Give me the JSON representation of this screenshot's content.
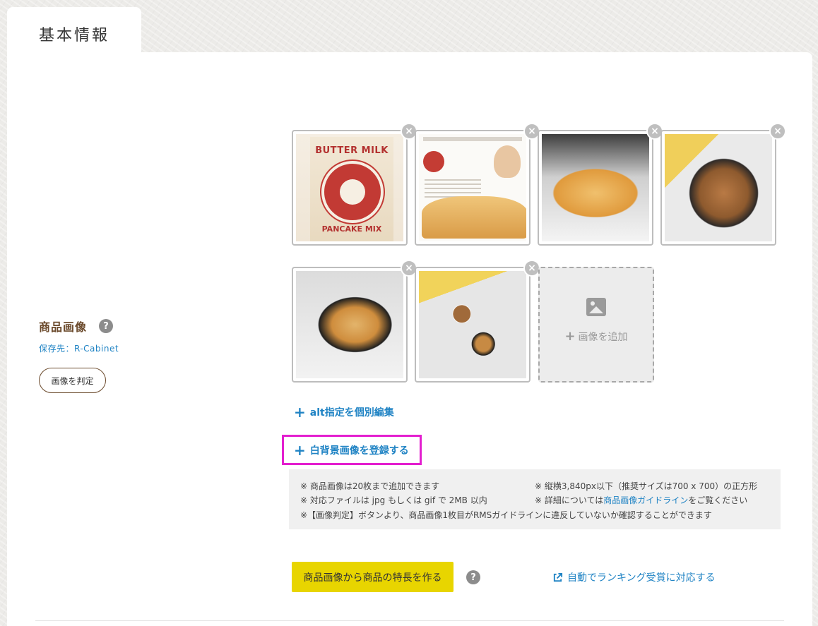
{
  "tab": {
    "label": "基本情報"
  },
  "product_image": {
    "label": "商品画像",
    "help": "?",
    "storage_label": "保存先：R-Cabinet",
    "judge_button": "画像を判定"
  },
  "images": [
    {
      "icon": "product-package-image"
    },
    {
      "icon": "product-flyer-image"
    },
    {
      "icon": "pancake-photo"
    },
    {
      "icon": "pancake-skillet-photo"
    },
    {
      "icon": "pancake-skillet-photo"
    },
    {
      "icon": "breakfast-table-photo"
    }
  ],
  "package_art": {
    "top": "BUTTER MILK",
    "bottom": "PANCAKE MIX"
  },
  "delete_glyph": "×",
  "add_image": {
    "plus": "+",
    "label": "画像を追加"
  },
  "links": {
    "plus": "+",
    "alt_edit": "alt指定を個別編集",
    "white_bg": "白背景画像を登録する"
  },
  "notes": {
    "left": [
      "※ 商品画像は20枚まで追加できます",
      "※ 対応ファイルは jpg もしくは gif で 2MB 以内"
    ],
    "right_1": "※ 縦横3,840px以下（推奨サイズは700 x 700）の正方形",
    "right_2_prefix": "※ 詳細については",
    "right_2_link": "商品画像ガイドライン",
    "right_2_suffix": "をご覧ください",
    "full": "※【画像判定】ボタンより、商品画像1枚目がRMSガイドラインに違反していないか確認することができます"
  },
  "feature_button": "商品画像から商品の特長を作る",
  "help_glyph": "?",
  "ranking_link": "自動でランキング受賞に対応する",
  "colors": {
    "link_blue": "#1f83c4",
    "label_brown": "#6b4a2c",
    "feature_yellow": "#e8d500",
    "highlight_magenta": "#e31fcf"
  }
}
